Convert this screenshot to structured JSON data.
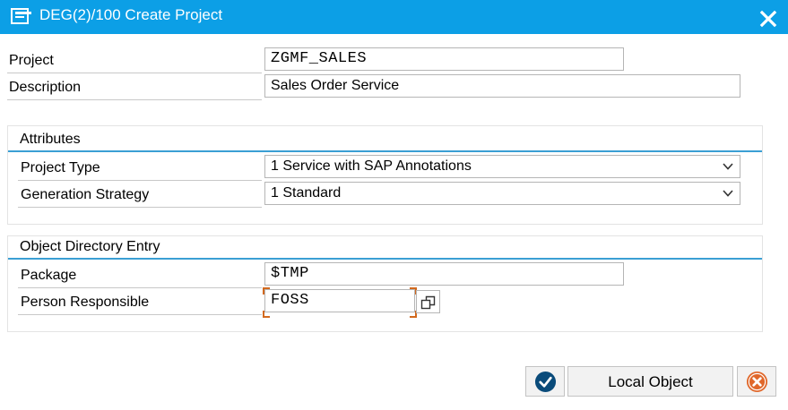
{
  "window": {
    "title": "DEG(2)/100 Create Project"
  },
  "fields": {
    "project_label": "Project",
    "project_value": "ZGMF_SALES",
    "description_label": "Description",
    "description_value": "Sales Order Service"
  },
  "attributes": {
    "title": "Attributes",
    "project_type_label": "Project Type",
    "project_type_value": "1 Service with SAP Annotations",
    "generation_strategy_label": "Generation Strategy",
    "generation_strategy_value": "1 Standard"
  },
  "object_directory": {
    "title": "Object Directory Entry",
    "package_label": "Package",
    "package_value": "$TMP",
    "person_label": "Person Responsible",
    "person_value": "FOSS"
  },
  "buttons": {
    "local_object_label": "Local Object"
  },
  "colors": {
    "titlebar": "#0c9fe6",
    "group_line": "#3a9fd4",
    "confirm": "#0a4b7a",
    "cancel": "#e0672a"
  }
}
